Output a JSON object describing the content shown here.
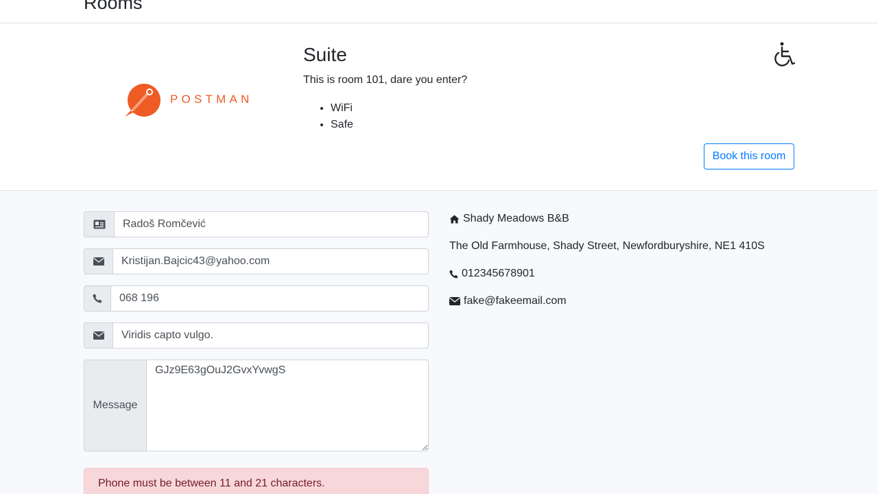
{
  "page": {
    "title": "Rooms"
  },
  "room": {
    "name": "Suite",
    "description": "This is room 101, dare you enter?",
    "features": [
      "WiFi",
      "Safe"
    ],
    "logo_text": "POSTMAN",
    "accessible_icon": "wheelchair-icon",
    "book_label": "Book this room"
  },
  "form": {
    "name": {
      "value": "Radoš Romčević",
      "icon": "id-card-icon"
    },
    "email": {
      "value": "Kristijan.Bajcic43@yahoo.com",
      "icon": "envelope-icon"
    },
    "phone": {
      "value": "068 196",
      "icon": "phone-icon"
    },
    "subject": {
      "value": "Viridis capto vulgo.",
      "icon": "envelope-icon"
    },
    "message": {
      "label": "Message",
      "value": "GJz9E63gOuJ2GvxYvwgS"
    },
    "error": "Phone must be between 11 and 21 characters."
  },
  "contact": {
    "name": "Shady Meadows B&B",
    "address": "The Old Farmhouse, Shady Street, Newfordburyshire, NE1 410S",
    "phone": "012345678901",
    "email": "fake@fakeemail.com"
  },
  "colors": {
    "accent": "#007bff",
    "logo": "#ef5b25",
    "alert_bg": "#f8d7da",
    "alert_text": "#721c24"
  }
}
